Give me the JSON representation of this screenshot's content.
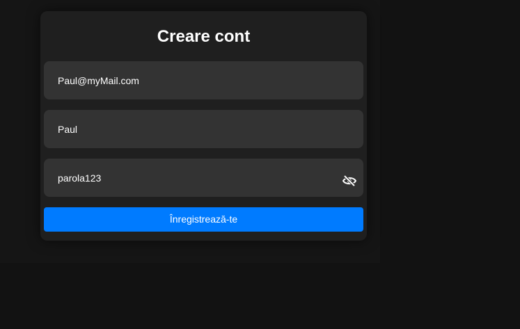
{
  "form": {
    "title": "Creare cont",
    "email_value": "Paul@myMail.com",
    "name_value": "Paul",
    "password_value": "parola123",
    "password_toggle_icon": "eye-slash-icon",
    "submit_label": "Înregistrează-te"
  },
  "colors": {
    "background": "#121212",
    "card": "#1f1f1f",
    "field": "#333333",
    "accent": "#007bff",
    "text": "#ffffff"
  }
}
